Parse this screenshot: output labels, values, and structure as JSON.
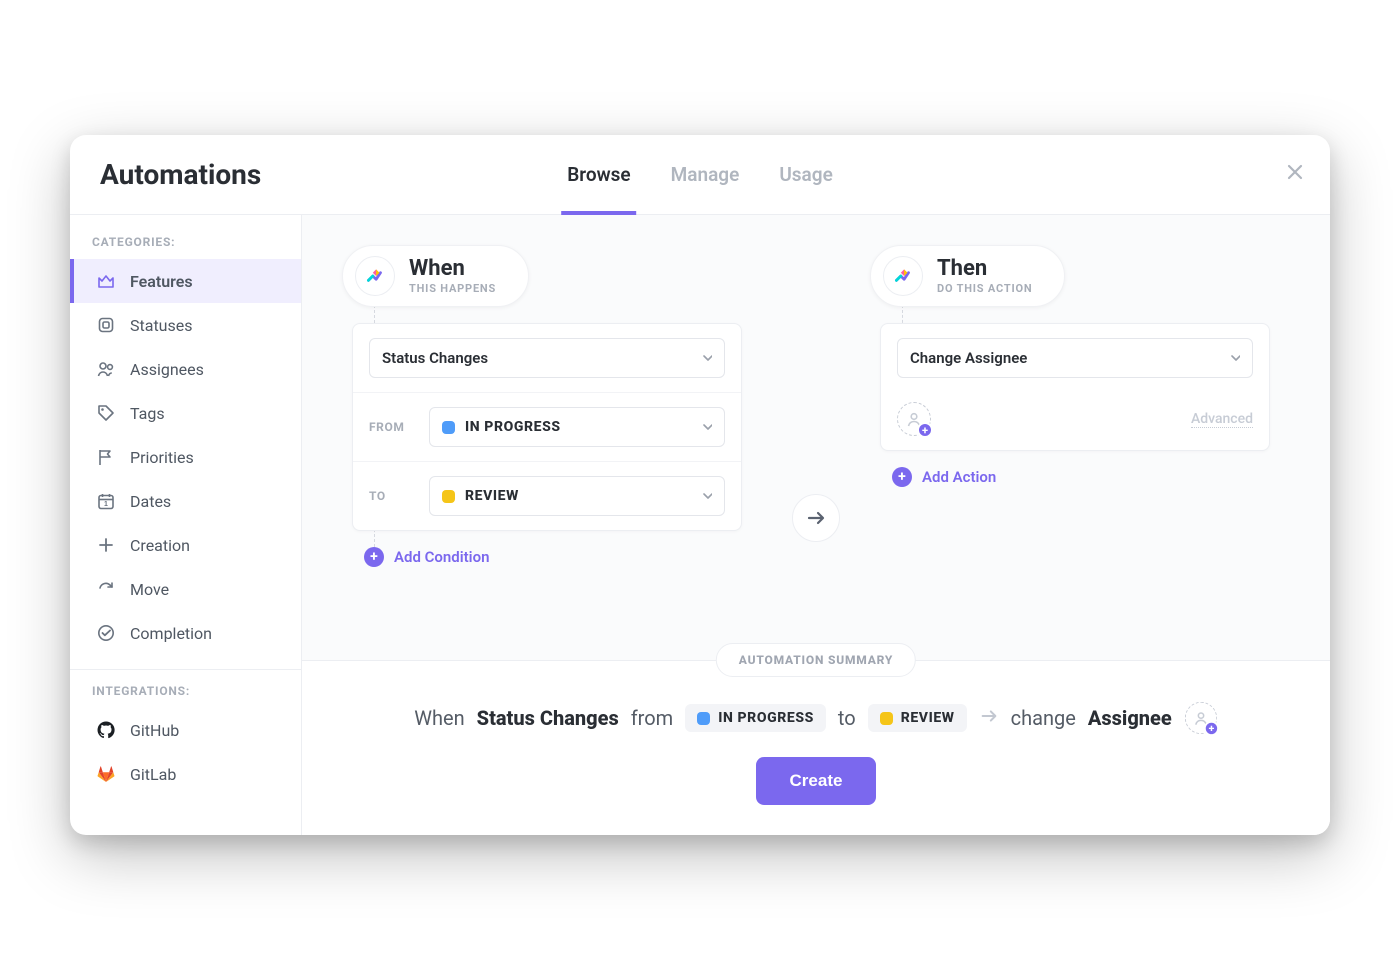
{
  "header": {
    "title": "Automations",
    "tabs": [
      {
        "label": "Browse",
        "active": true
      },
      {
        "label": "Manage",
        "active": false
      },
      {
        "label": "Usage",
        "active": false
      }
    ]
  },
  "sidebar": {
    "categories_title": "CATEGORIES:",
    "items": [
      {
        "label": "Features",
        "icon": "crown-icon",
        "active": true
      },
      {
        "label": "Statuses",
        "icon": "square-icon",
        "active": false
      },
      {
        "label": "Assignees",
        "icon": "people-icon",
        "active": false
      },
      {
        "label": "Tags",
        "icon": "tag-icon",
        "active": false
      },
      {
        "label": "Priorities",
        "icon": "flag-icon",
        "active": false
      },
      {
        "label": "Dates",
        "icon": "calendar-icon",
        "active": false
      },
      {
        "label": "Creation",
        "icon": "plus-icon",
        "active": false
      },
      {
        "label": "Move",
        "icon": "redo-icon",
        "active": false
      },
      {
        "label": "Completion",
        "icon": "check-circle-icon",
        "active": false
      }
    ],
    "integrations_title": "INTEGRATIONS:",
    "integrations": [
      {
        "label": "GitHub",
        "icon": "github-icon"
      },
      {
        "label": "GitLab",
        "icon": "gitlab-icon"
      }
    ]
  },
  "when": {
    "title": "When",
    "subtitle": "THIS HAPPENS",
    "trigger_label": "Status Changes",
    "from_label": "FROM",
    "from_status": "IN PROGRESS",
    "from_color": "blue",
    "to_label": "TO",
    "to_status": "REVIEW",
    "to_color": "yellow",
    "add_condition_label": "Add Condition"
  },
  "then": {
    "title": "Then",
    "subtitle": "DO THIS ACTION",
    "action_label": "Change Assignee",
    "advanced_label": "Advanced",
    "add_action_label": "Add Action"
  },
  "summary": {
    "badge": "AUTOMATION SUMMARY",
    "when_word": "When",
    "trigger": "Status Changes",
    "from_word": "from",
    "from_status": "IN PROGRESS",
    "to_word": "to",
    "to_status": "REVIEW",
    "change_word": "change",
    "target": "Assignee",
    "create_button": "Create"
  },
  "colors": {
    "accent": "#7b68ee",
    "status_blue": "#4f9cf9",
    "status_yellow": "#f5c518"
  }
}
